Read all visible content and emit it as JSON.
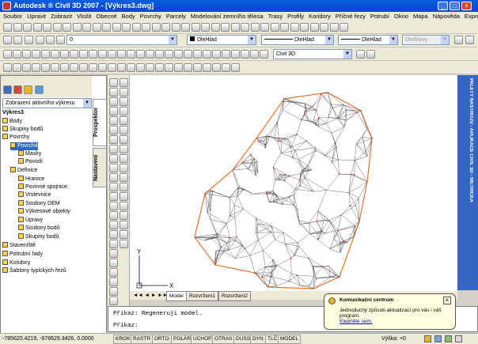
{
  "window": {
    "title": "Autodesk ® Civil 3D 2007 - [Výkres3.dwg]"
  },
  "menu": [
    "Soubor",
    "Upravit",
    "Zobrazit",
    "Vložit",
    "Obecné",
    "Body",
    "Povrchy",
    "Parcely",
    "Modelování zemního tělesa",
    "Trasy",
    "Profily",
    "Koridory",
    "Příčné řezy",
    "Potrubí",
    "Okno",
    "Mapa",
    "Nápověda",
    "Express"
  ],
  "toolbar": {
    "layer_value": "0",
    "color_value": "DleHlad",
    "linetype_value": "DleHlad",
    "lineweight_value": "DleHlad",
    "plotstyle_value": "DleBarvy",
    "workspace_value": "Civil 3D"
  },
  "toolspace": {
    "view_select": "Zobrazení aktivního výkresu",
    "tab_prospektor": "Prospektor",
    "tab_nastaveni": "Nastavení",
    "tree": [
      "Výkres3",
      "Body",
      "Skupiny bodů",
      "Povrchy",
      "Povrch4",
      "Masky",
      "Povodí",
      "Definice",
      "Hranice",
      "Povinné spojnice",
      "Vrstevnice",
      "Soubory DEM",
      "Výkresové objekty",
      "Úpravy",
      "Soubory bodů",
      "Skupiny bodů",
      "Staveniště",
      "Potrubní řady",
      "Koridory",
      "Šablony typických řezů"
    ]
  },
  "palette": {
    "label": "PALETY NÁSTROJŮ - APLIKACE CIVIL 3D - METRICKÁ"
  },
  "layout_tabs": [
    "Model",
    "Rozvržení1",
    "Rozvržení2"
  ],
  "ucs": {
    "x": "X",
    "y": "Y"
  },
  "command": {
    "line1": "Příkaz: Regeneruji model.",
    "line2": "Příkaz:"
  },
  "status": {
    "coords": "-785620.4219, -978629.3426, 0.0000",
    "buttons": [
      "KROK",
      "RASTR",
      "ORTO",
      "POLÁR",
      "UCHOP",
      "OTRAS",
      "DUSS",
      "DYN",
      "TLČ",
      "MODEL"
    ],
    "elevation": "Výška: +0"
  },
  "notification": {
    "title": "Komunikační centrum",
    "body": "Jednoduchý způsob aktualizací pro vás i váš program.",
    "link": "Klepněte sem."
  },
  "colors": {
    "titlebar": "#0845c8",
    "palette": "#3467c3",
    "surface_border": "#e8742a",
    "tin": "#444444"
  }
}
